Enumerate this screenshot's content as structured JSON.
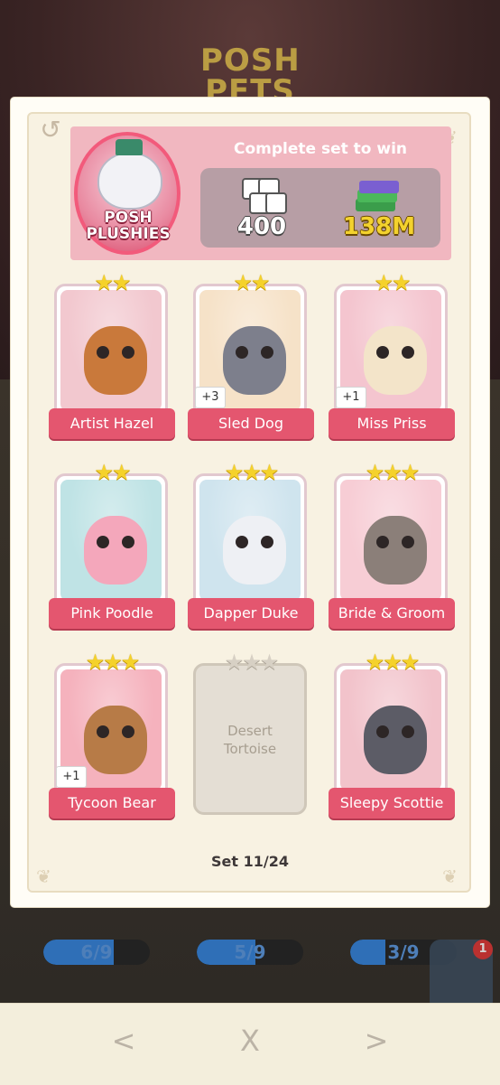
{
  "background": {
    "logo_text": "POSH PETS",
    "progress": [
      {
        "text": "6/9",
        "fraction": 0.66
      },
      {
        "text": "5/9",
        "fraction": 0.55
      },
      {
        "text": "3/9",
        "fraction": 0.33
      }
    ],
    "badge_count": "1"
  },
  "album": {
    "name": "POSH PLUSHIES",
    "reward_title": "Complete set to win",
    "rewards": {
      "dice": "400",
      "cash": "138M"
    },
    "set_label": "Set 11/24"
  },
  "pets": [
    {
      "name": "Artist Hazel",
      "stars": 2,
      "extra": "",
      "locked": false,
      "bg": "#f2c8cf",
      "body": "#c9793b"
    },
    {
      "name": "Sled Dog",
      "stars": 2,
      "extra": "+3",
      "locked": false,
      "bg": "#f6e2c8",
      "body": "#7d7f8c"
    },
    {
      "name": "Miss Priss",
      "stars": 2,
      "extra": "+1",
      "locked": false,
      "bg": "#f4c5cf",
      "body": "#f3e4c9"
    },
    {
      "name": "Pink Poodle",
      "stars": 2,
      "extra": "",
      "locked": false,
      "bg": "#bfe3e5",
      "body": "#f4a7bb"
    },
    {
      "name": "Dapper Duke",
      "stars": 3,
      "extra": "",
      "locked": false,
      "bg": "#cfe4ee",
      "body": "#eef0f4"
    },
    {
      "name": "Bride & Groom",
      "stars": 3,
      "extra": "",
      "locked": false,
      "bg": "#f7cdd5",
      "body": "#8b7f79"
    },
    {
      "name": "Tycoon Bear",
      "stars": 3,
      "extra": "+1",
      "locked": false,
      "bg": "#f5b2bd",
      "body": "#b77b47"
    },
    {
      "name": "Desert Tortoise",
      "stars": 3,
      "extra": "",
      "locked": true,
      "bg": "#e4ded4",
      "body": "#e4ded4"
    },
    {
      "name": "Sleepy Scottie",
      "stars": 3,
      "extra": "",
      "locked": false,
      "bg": "#f2c3cb",
      "body": "#5c5c66"
    }
  ],
  "nav": {
    "prev": "<",
    "close": "X",
    "next": ">"
  },
  "icons": {
    "history": "history-icon",
    "dice": "dice-icon",
    "cash": "cash-stack-icon"
  },
  "colors": {
    "label_red": "#e4566f",
    "header_pink": "#f1b7c0",
    "star_gold": "#f5d22b"
  }
}
